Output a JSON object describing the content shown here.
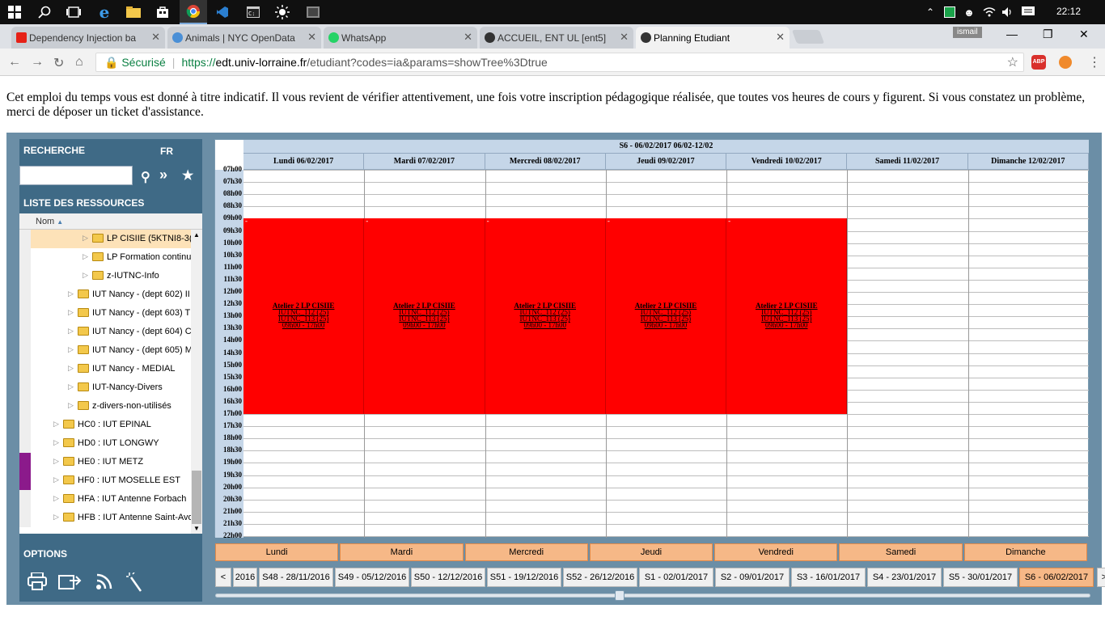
{
  "taskbar": {
    "icons": [
      "windows-start-icon",
      "search-icon",
      "task-view-icon",
      "edge-icon",
      "file-explorer-icon",
      "store-icon",
      "chrome-icon",
      "vscode-icon",
      "cmd-icon",
      "brightness-icon",
      "app-icon"
    ],
    "tray": [
      "chevron-up-icon",
      "app-tray-icon",
      "people-icon",
      "wifi-icon",
      "volume-icon",
      "notification-icon"
    ],
    "time": "22:12"
  },
  "browser": {
    "tabs": [
      {
        "label": "Dependency Injection ba",
        "color": "#e62117"
      },
      {
        "label": "Animals | NYC OpenData",
        "color": "#4a8fd6"
      },
      {
        "label": "WhatsApp",
        "color": "#25d366"
      },
      {
        "label": "ACCUEIL, ENT UL [ent5]",
        "color": "#333333"
      },
      {
        "label": "Planning Etudiant",
        "color": "#333333"
      }
    ],
    "profile": "ismail",
    "secure_label": "Sécurisé",
    "url_proto": "https://",
    "url_host": "edt.univ-lorraine.fr",
    "url_path": "/etudiant?codes=ia&params=showTree%3Dtrue",
    "abp_label": "ABP"
  },
  "notice": "Cet emploi du temps vous est donné à titre indicatif. Il vous revient de vérifier attentivement, une fois votre inscription pédagogique réalisée, que toutes vos heures de cours y figurent. Si vous constatez un problème, merci de déposer un ticket d'assistance.",
  "sidebar": {
    "search_title": "RECHERCHE",
    "lang": "FR",
    "resources_title": "LISTE DES RESSOURCES",
    "column_header": "Nom",
    "options_title": "OPTIONS",
    "tree": [
      {
        "label": "LP CISIIE (5KTNI8-3(",
        "level": 3,
        "selected": true,
        "mark": ""
      },
      {
        "label": "LP Formation continu",
        "level": 3,
        "selected": false,
        "mark": ""
      },
      {
        "label": "z-IUTNC-Info",
        "level": 3,
        "selected": false,
        "mark": ""
      },
      {
        "label": "IUT Nancy - (dept 602) II",
        "level": 2,
        "selected": false,
        "mark": ""
      },
      {
        "label": "IUT Nancy - (dept 603) T",
        "level": 2,
        "selected": false,
        "mark": ""
      },
      {
        "label": "IUT Nancy - (dept 604) C",
        "level": 2,
        "selected": false,
        "mark": ""
      },
      {
        "label": "IUT Nancy - (dept 605) M",
        "level": 2,
        "selected": false,
        "mark": ""
      },
      {
        "label": "IUT Nancy - MEDIAL",
        "level": 2,
        "selected": false,
        "mark": ""
      },
      {
        "label": "IUT-Nancy-Divers",
        "level": 2,
        "selected": false,
        "mark": ""
      },
      {
        "label": "z-divers-non-utilisés",
        "level": 2,
        "selected": false,
        "mark": ""
      },
      {
        "label": "HC0 : IUT EPINAL",
        "level": 1,
        "selected": false,
        "mark": ""
      },
      {
        "label": "HD0 : IUT LONGWY",
        "level": 1,
        "selected": false,
        "mark": ""
      },
      {
        "label": "HE0 : IUT METZ",
        "level": 1,
        "selected": false,
        "mark": "#8b1a8b"
      },
      {
        "label": "HF0 : IUT MOSELLE EST",
        "level": 1,
        "selected": false,
        "mark": "#8b1a8b"
      },
      {
        "label": "HFA : IUT Antenne Forbach",
        "level": 1,
        "selected": false,
        "mark": ""
      },
      {
        "label": "HFB : IUT Antenne Saint-Avo",
        "level": 1,
        "selected": false,
        "mark": ""
      }
    ]
  },
  "calendar": {
    "week_title": "S6 - 06/02/2017 06/02-12/02",
    "days": [
      "Lundi 06/02/2017",
      "Mardi 07/02/2017",
      "Mercredi 08/02/2017",
      "Jeudi 09/02/2017",
      "Vendredi 10/02/2017",
      "Samedi 11/02/2017",
      "Dimanche 12/02/2017"
    ],
    "times": [
      "07h00",
      "07h30",
      "08h00",
      "08h30",
      "09h00",
      "09h30",
      "10h00",
      "10h30",
      "11h00",
      "11h30",
      "12h00",
      "12h30",
      "13h00",
      "13h30",
      "14h00",
      "14h30",
      "15h00",
      "15h30",
      "16h00",
      "16h30",
      "17h00",
      "17h30",
      "18h00",
      "18h30",
      "19h00",
      "19h30",
      "20h00",
      "20h30",
      "21h00",
      "21h30",
      "22h00"
    ],
    "event_color": "#ff0000",
    "events": [
      {
        "day": 0,
        "start": "09h00",
        "end": "17h00",
        "title": "Atelier 2 LP CISIIE",
        "room1": "IUTNC_112 (25)",
        "room2": "IUTNC_113 (25)",
        "time": "09h00 - 17h00"
      },
      {
        "day": 1,
        "start": "09h00",
        "end": "17h00",
        "title": "Atelier 2 LP CISIIE",
        "room1": "IUTNC_112 (25)",
        "room2": "IUTNC_113 (25)",
        "time": "09h00 - 17h00"
      },
      {
        "day": 2,
        "start": "09h00",
        "end": "17h00",
        "title": "Atelier 2 LP CISIIE",
        "room1": "IUTNC_112 (25)",
        "room2": "IUTNC_113 (25)",
        "time": "09h00 - 17h00"
      },
      {
        "day": 3,
        "start": "09h00",
        "end": "17h00",
        "title": "Atelier 2 LP CISIIE",
        "room1": "IUTNC_112 (25)",
        "room2": "IUTNC_113 (25)",
        "time": "09h00 - 17h00"
      },
      {
        "day": 4,
        "start": "09h00",
        "end": "17h00",
        "title": "Atelier 2 LP CISIIE",
        "room1": "IUTNC_112 (25)",
        "room2": "IUTNC_113 (25)",
        "time": "09h00 - 17h00"
      }
    ]
  },
  "day_buttons": [
    "Lundi",
    "Mardi",
    "Mercredi",
    "Jeudi",
    "Vendredi",
    "Samedi",
    "Dimanche"
  ],
  "week_nav": {
    "prev": "<",
    "next": ">",
    "weeks": [
      "2016",
      "S48 - 28/11/2016",
      "S49 - 05/12/2016",
      "S50 - 12/12/2016",
      "S51 - 19/12/2016",
      "S52 - 26/12/2016",
      "S1 - 02/01/2017",
      "S2 - 09/01/2017",
      "S3 - 16/01/2017",
      "S4 - 23/01/2017",
      "S5 - 30/01/2017",
      "S6 - 06/02/2017"
    ],
    "current_index": 11,
    "accent": "#f6b887"
  }
}
